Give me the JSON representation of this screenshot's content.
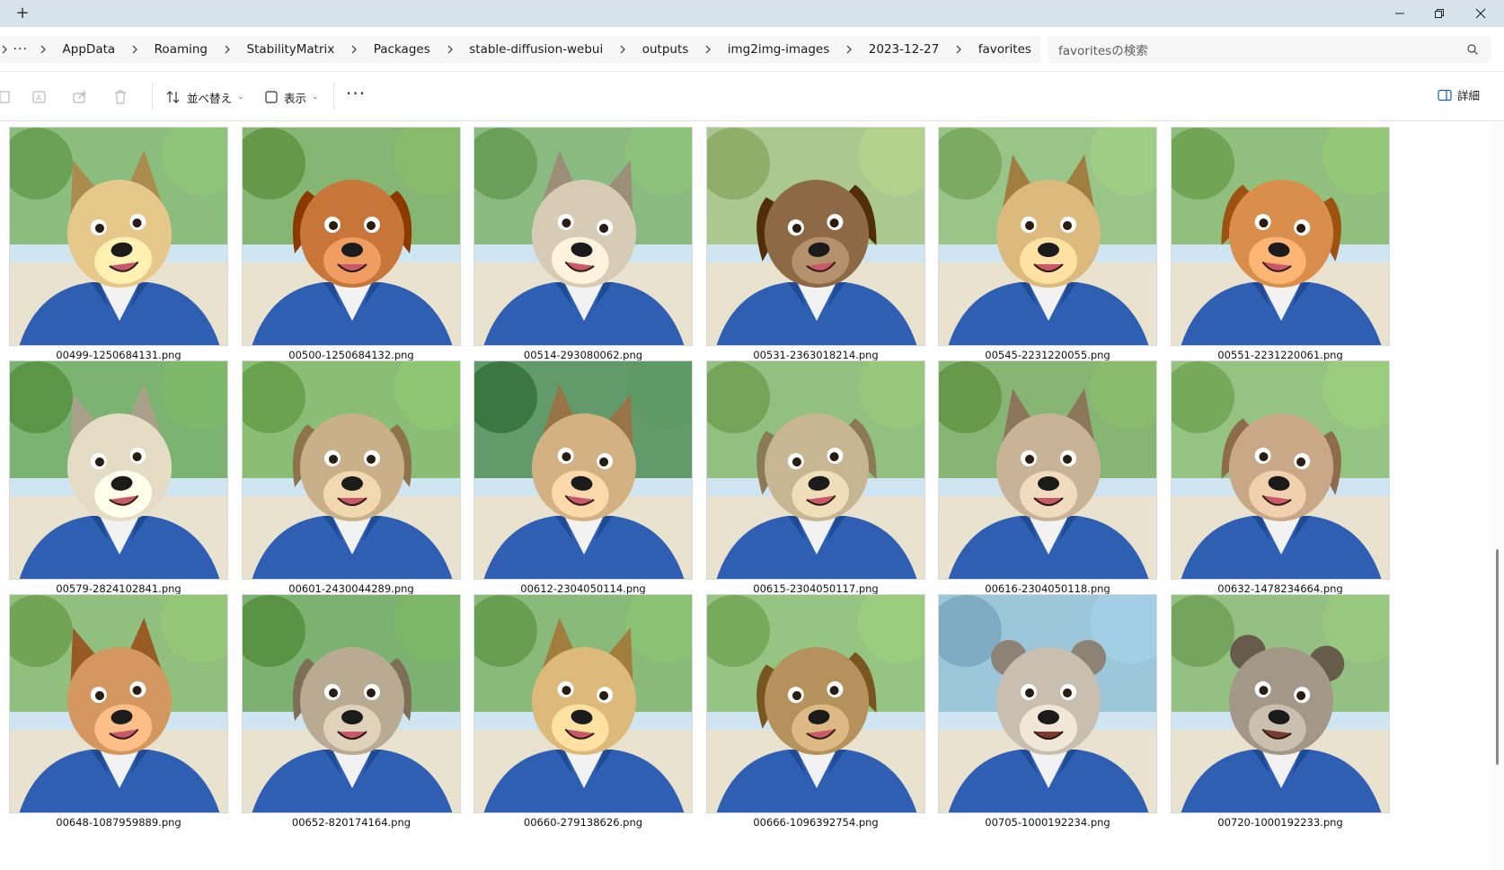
{
  "window": {
    "new_tab_glyph": "+",
    "controls": [
      "minimize",
      "maximize",
      "close"
    ]
  },
  "address": {
    "more_glyph": "···",
    "breadcrumbs": [
      "AppData",
      "Roaming",
      "StabilityMatrix",
      "Packages",
      "stable-diffusion-webui",
      "outputs",
      "img2img-images",
      "2023-12-27",
      "favorites"
    ]
  },
  "search": {
    "placeholder": "favoritesの検索"
  },
  "toolbar": {
    "sort_label": "並べ替え",
    "view_label": "表示",
    "more_glyph": "···",
    "details_label": "詳細"
  },
  "files": [
    {
      "name": "00499-1250684131.png",
      "fur": "#e6c98a",
      "bg": "#7fb56a",
      "icon": "dog-thumbnail"
    },
    {
      "name": "00500-1250684132.png",
      "fur": "#c8753a",
      "bg": "#78ad5e",
      "icon": "dog-thumbnail"
    },
    {
      "name": "00514-293080062.png",
      "fur": "#d8cbb5",
      "bg": "#7db36c",
      "icon": "dog-thumbnail"
    },
    {
      "name": "00531-2363018214.png",
      "fur": "#8d6a45",
      "bg": "#a3c27e",
      "icon": "dog-thumbnail"
    },
    {
      "name": "00545-2231220055.png",
      "fur": "#dcb97c",
      "bg": "#8fbf76",
      "icon": "dog-thumbnail"
    },
    {
      "name": "00551-2231220061.png",
      "fur": "#d98e4c",
      "bg": "#86b86a",
      "icon": "dog-thumbnail"
    },
    {
      "name": "00579-2824102841.png",
      "fur": "#e4dcc4",
      "bg": "#6fa95c",
      "icon": "dog-thumbnail"
    },
    {
      "name": "00601-2430044289.png",
      "fur": "#c9b088",
      "bg": "#7eb662",
      "icon": "dog-thumbnail"
    },
    {
      "name": "00612-2304050114.png",
      "fur": "#d3b182",
      "bg": "#4f8c55",
      "icon": "dog-thumbnail"
    },
    {
      "name": "00615-2304050117.png",
      "fur": "#c8b592",
      "bg": "#87b86c",
      "icon": "dog-thumbnail"
    },
    {
      "name": "00616-2304050118.png",
      "fur": "#c9b396",
      "bg": "#7aad5e",
      "icon": "dog-thumbnail"
    },
    {
      "name": "00632-1478234664.png",
      "fur": "#c9a887",
      "bg": "#8bbd6f",
      "icon": "dog-thumbnail"
    },
    {
      "name": "00648-1087959889.png",
      "fur": "#d49760",
      "bg": "#86b86a",
      "icon": "dog-thumbnail"
    },
    {
      "name": "00652-820174164.png",
      "fur": "#b9ab93",
      "bg": "#6ea75a",
      "icon": "dog-thumbnail"
    },
    {
      "name": "00660-279138626.png",
      "fur": "#ddb97a",
      "bg": "#7cb264",
      "icon": "dog-thumbnail"
    },
    {
      "name": "00666-1096392754.png",
      "fur": "#b5925c",
      "bg": "#8cbe70",
      "icon": "dog-thumbnail"
    },
    {
      "name": "00705-1000192234.png",
      "fur": "#c9bfb0",
      "bg": "#93c0d6",
      "icon": "bear-thumbnail"
    },
    {
      "name": "00720-1000192233.png",
      "fur": "#a39888",
      "bg": "#89b970",
      "icon": "bear-thumbnail"
    }
  ]
}
